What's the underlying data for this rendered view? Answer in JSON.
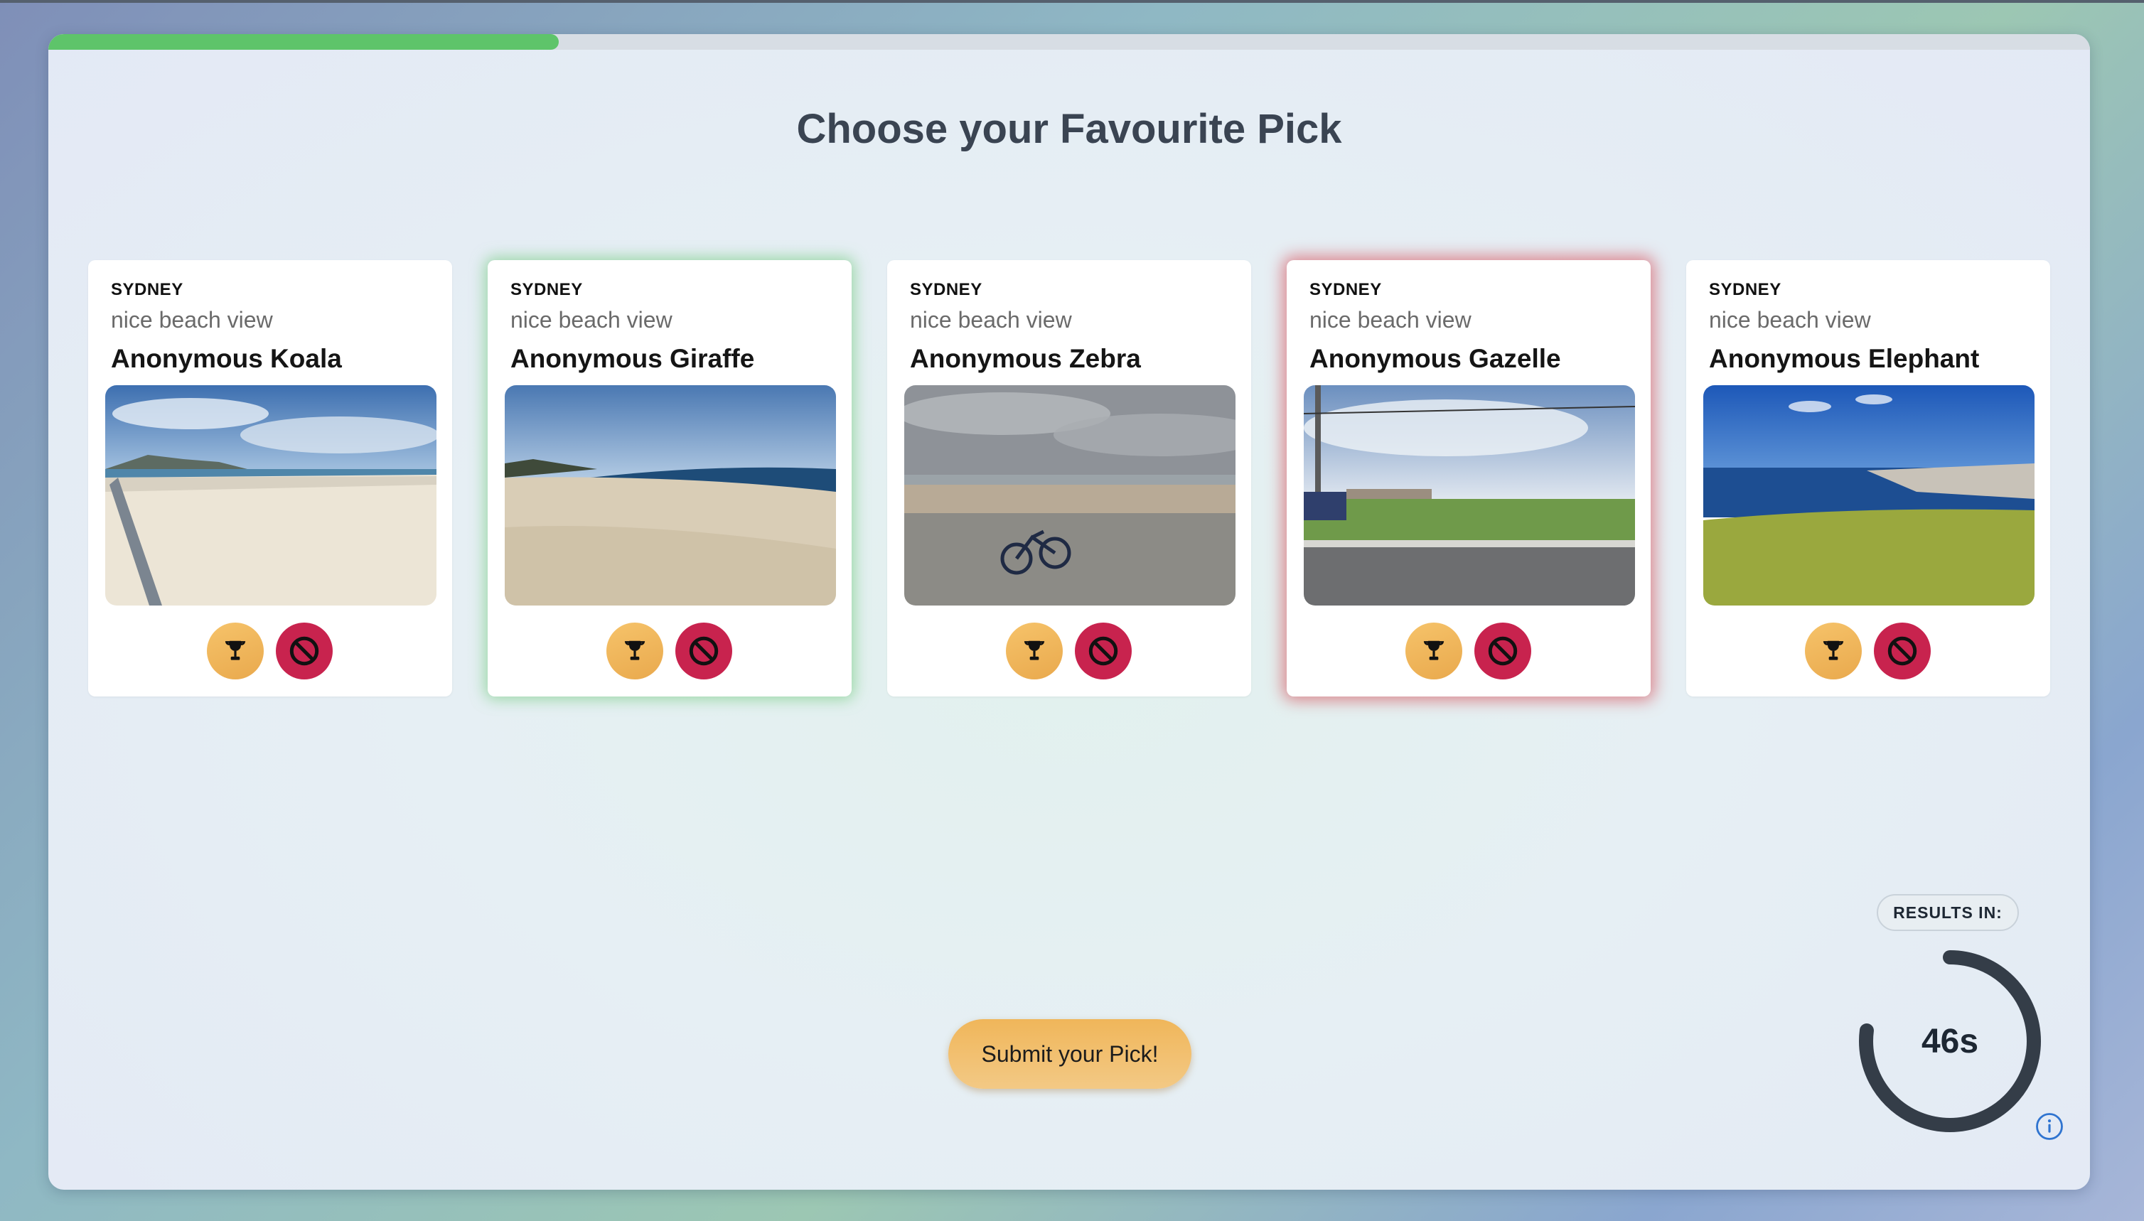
{
  "progress": {
    "fraction": 0.25
  },
  "title": "Choose your Favourite Pick",
  "cards": [
    {
      "city": "SYDNEY",
      "description": "nice beach view",
      "name": "Anonymous Koala",
      "highlight": "none",
      "photo": "beach-promenade"
    },
    {
      "city": "SYDNEY",
      "description": "nice beach view",
      "name": "Anonymous Giraffe",
      "highlight": "green",
      "photo": "sandy-beach"
    },
    {
      "city": "SYDNEY",
      "description": "nice beach view",
      "name": "Anonymous Zebra",
      "highlight": "none",
      "photo": "bicycle-beach"
    },
    {
      "city": "SYDNEY",
      "description": "nice beach view",
      "name": "Anonymous Gazelle",
      "highlight": "red",
      "photo": "grass-road"
    },
    {
      "city": "SYDNEY",
      "description": "nice beach view",
      "name": "Anonymous Elephant",
      "highlight": "none",
      "photo": "bay-view"
    }
  ],
  "actions": {
    "trophy_icon": "trophy-icon",
    "block_icon": "block-icon"
  },
  "submit_label": "Submit your Pick!",
  "results": {
    "label": "RESULTS IN:",
    "countdown": "46s",
    "remaining_fraction": 0.77
  },
  "colors": {
    "progress": "#5ec46a",
    "accent": "#f0b65a",
    "block": "#c8234e",
    "selected": "#5ec46a",
    "rejected": "#d64650"
  }
}
